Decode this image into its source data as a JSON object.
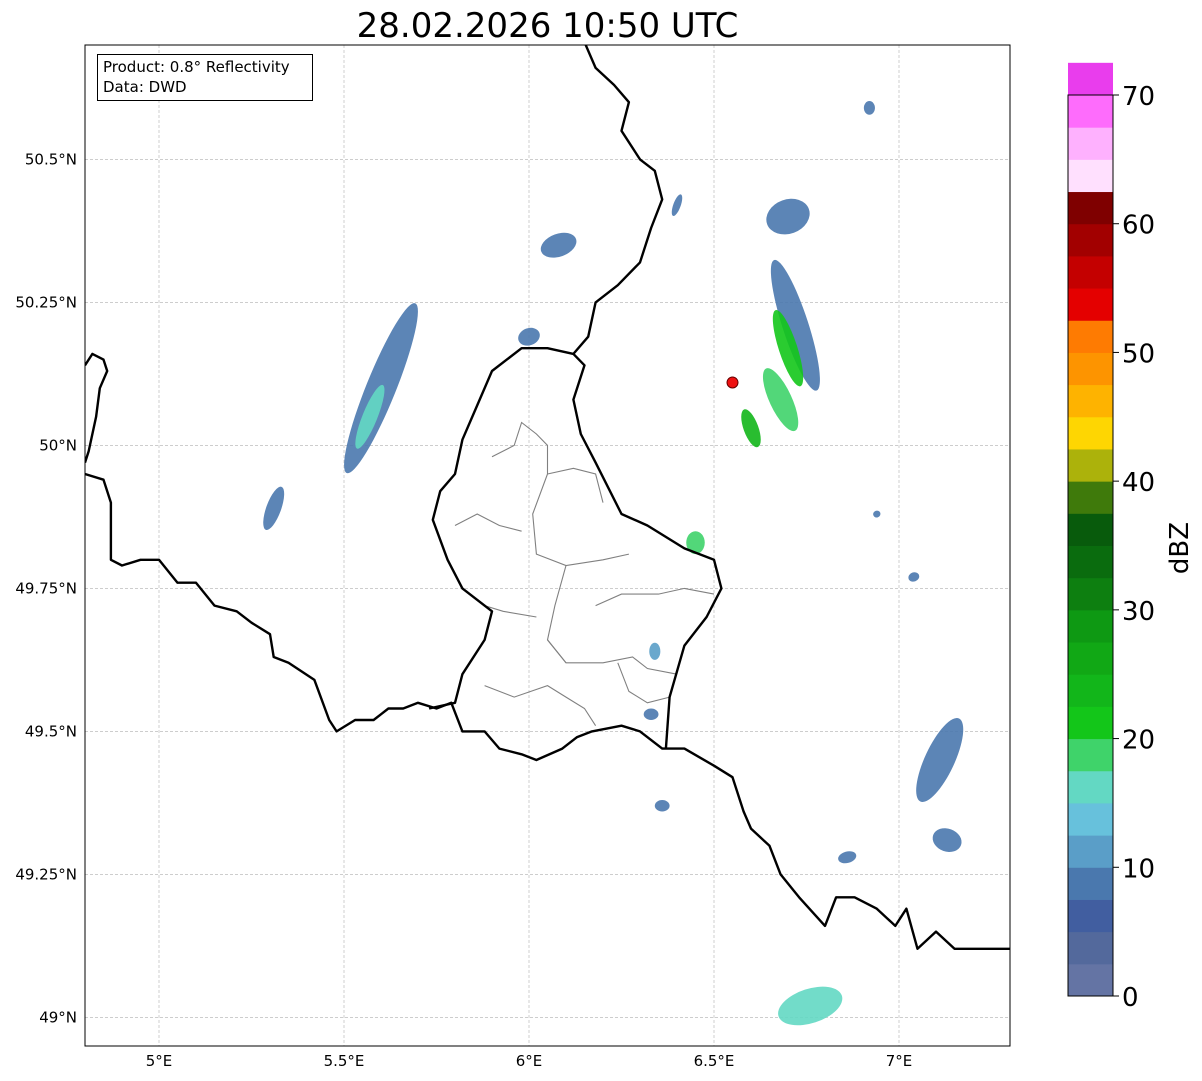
{
  "title": "28.02.2026 10:50 UTC",
  "info_box": {
    "product_line": "Product: 0.8° Reflectivity",
    "source_line": "Data: DWD"
  },
  "map": {
    "lon_range": [
      4.8,
      7.3
    ],
    "lat_range": [
      48.95,
      50.7
    ],
    "lon_ticks": [
      {
        "value": 5.0,
        "label": "5°E"
      },
      {
        "value": 5.5,
        "label": "5.5°E"
      },
      {
        "value": 6.0,
        "label": "6°E"
      },
      {
        "value": 6.5,
        "label": "6.5°E"
      },
      {
        "value": 7.0,
        "label": "7°E"
      }
    ],
    "lat_ticks": [
      {
        "value": 50.5,
        "label": "50.5°N"
      },
      {
        "value": 50.25,
        "label": "50.25°N"
      },
      {
        "value": 50.0,
        "label": "50°N"
      },
      {
        "value": 49.75,
        "label": "49.75°N"
      },
      {
        "value": 49.5,
        "label": "49.5°N"
      },
      {
        "value": 49.25,
        "label": "49.25°N"
      },
      {
        "value": 49.0,
        "label": "49°N"
      }
    ],
    "radar_site": {
      "lon": 6.55,
      "lat": 50.11
    },
    "gridlines": true
  },
  "colorbar": {
    "label": "dBZ",
    "min": 0,
    "max": 70,
    "step": 2.5,
    "tick_values": [
      0,
      10,
      20,
      30,
      40,
      50,
      60,
      70
    ],
    "tick_labels": [
      "0",
      "10",
      "20",
      "30",
      "40",
      "50",
      "60",
      "70"
    ],
    "colors": [
      "#6474a4",
      "#53699c",
      "#415ea0",
      "#4a78ae",
      "#5a9ec8",
      "#67c1dc",
      "#63d8c3",
      "#3fd36a",
      "#13c619",
      "#12b61a",
      "#11a815",
      "#0e9913",
      "#0d7f10",
      "#0a6c0e",
      "#085b0c",
      "#3f7a0b",
      "#acb20b",
      "#fed602",
      "#feb300",
      "#fd9400",
      "#fe7b02",
      "#e40000",
      "#c40000",
      "#a20000",
      "#7f0000",
      "#ffe0fe",
      "#feb1fe",
      "#fe6cfc",
      "#e93ded"
    ]
  },
  "echoes": [
    {
      "lon": 6.72,
      "lat": 50.21,
      "rx": 0.035,
      "ry": 0.12,
      "rot": -18,
      "color": "#4a78ae"
    },
    {
      "lon": 6.7,
      "lat": 50.17,
      "rx": 0.025,
      "ry": 0.07,
      "rot": -18,
      "color": "#13c619"
    },
    {
      "lon": 6.68,
      "lat": 50.08,
      "rx": 0.03,
      "ry": 0.06,
      "rot": -25,
      "color": "#3fd36a"
    },
    {
      "lon": 6.7,
      "lat": 50.4,
      "rx": 0.06,
      "ry": 0.03,
      "rot": -20,
      "color": "#4a78ae"
    },
    {
      "lon": 6.6,
      "lat": 50.03,
      "rx": 0.02,
      "ry": 0.035,
      "rot": -20,
      "color": "#12b61a"
    },
    {
      "lon": 5.6,
      "lat": 50.1,
      "rx": 0.04,
      "ry": 0.16,
      "rot": 22,
      "color": "#4a78ae"
    },
    {
      "lon": 5.57,
      "lat": 50.05,
      "rx": 0.02,
      "ry": 0.06,
      "rot": 22,
      "color": "#63d8c3"
    },
    {
      "lon": 5.31,
      "lat": 49.89,
      "rx": 0.02,
      "ry": 0.04,
      "rot": 20,
      "color": "#4a78ae"
    },
    {
      "lon": 6.08,
      "lat": 50.35,
      "rx": 0.05,
      "ry": 0.02,
      "rot": -20,
      "color": "#4a78ae"
    },
    {
      "lon": 6.45,
      "lat": 49.83,
      "rx": 0.025,
      "ry": 0.02,
      "rot": 0,
      "color": "#3fd36a"
    },
    {
      "lon": 7.11,
      "lat": 49.45,
      "rx": 0.04,
      "ry": 0.08,
      "rot": 25,
      "color": "#4a78ae"
    },
    {
      "lon": 7.13,
      "lat": 49.31,
      "rx": 0.04,
      "ry": 0.02,
      "rot": 20,
      "color": "#4a78ae"
    },
    {
      "lon": 6.76,
      "lat": 49.02,
      "rx": 0.09,
      "ry": 0.03,
      "rot": -18,
      "color": "#63d8c3"
    },
    {
      "lon": 6.36,
      "lat": 49.37,
      "rx": 0.02,
      "ry": 0.01,
      "rot": 0,
      "color": "#4a78ae"
    },
    {
      "lon": 6.86,
      "lat": 49.28,
      "rx": 0.025,
      "ry": 0.01,
      "rot": -15,
      "color": "#4a78ae"
    },
    {
      "lon": 6.33,
      "lat": 49.53,
      "rx": 0.02,
      "ry": 0.01,
      "rot": 0,
      "color": "#4a78ae"
    },
    {
      "lon": 6.34,
      "lat": 49.64,
      "rx": 0.015,
      "ry": 0.015,
      "rot": 0,
      "color": "#5a9ec8"
    },
    {
      "lon": 6.92,
      "lat": 50.59,
      "rx": 0.015,
      "ry": 0.012,
      "rot": 0,
      "color": "#4a78ae"
    },
    {
      "lon": 6.4,
      "lat": 50.42,
      "rx": 0.01,
      "ry": 0.02,
      "rot": 20,
      "color": "#4a78ae"
    },
    {
      "lon": 6.0,
      "lat": 50.19,
      "rx": 0.03,
      "ry": 0.015,
      "rot": -20,
      "color": "#4a78ae"
    },
    {
      "lon": 7.04,
      "lat": 49.77,
      "rx": 0.015,
      "ry": 0.008,
      "rot": -20,
      "color": "#4a78ae"
    },
    {
      "lon": 6.94,
      "lat": 49.88,
      "rx": 0.01,
      "ry": 0.006,
      "rot": -20,
      "color": "#4a78ae"
    }
  ],
  "borders": {
    "national": [
      [
        [
          4.8,
          50.14
        ],
        [
          4.82,
          50.16
        ],
        [
          4.85,
          50.15
        ],
        [
          4.86,
          50.13
        ],
        [
          4.84,
          50.1
        ],
        [
          4.83,
          50.05
        ],
        [
          4.81,
          49.99
        ],
        [
          4.8,
          49.97
        ]
      ],
      [
        [
          4.8,
          49.95
        ],
        [
          4.85,
          49.94
        ],
        [
          4.87,
          49.9
        ],
        [
          4.87,
          49.8
        ],
        [
          4.9,
          49.79
        ],
        [
          4.95,
          49.8
        ],
        [
          5.0,
          49.8
        ],
        [
          5.05,
          49.76
        ],
        [
          5.1,
          49.76
        ],
        [
          5.15,
          49.72
        ],
        [
          5.21,
          49.71
        ],
        [
          5.25,
          49.69
        ],
        [
          5.3,
          49.67
        ],
        [
          5.31,
          49.63
        ],
        [
          5.35,
          49.62
        ],
        [
          5.42,
          49.59
        ],
        [
          5.46,
          49.52
        ],
        [
          5.48,
          49.5
        ],
        [
          5.53,
          49.52
        ],
        [
          5.58,
          49.52
        ],
        [
          5.62,
          49.54
        ],
        [
          5.66,
          49.54
        ],
        [
          5.7,
          49.55
        ],
        [
          5.75,
          49.54
        ],
        [
          5.79,
          49.55
        ],
        [
          5.82,
          49.5
        ],
        [
          5.88,
          49.5
        ],
        [
          5.92,
          49.47
        ],
        [
          5.98,
          49.46
        ],
        [
          6.02,
          49.45
        ],
        [
          6.09,
          49.47
        ],
        [
          6.13,
          49.49
        ],
        [
          6.17,
          49.5
        ],
        [
          6.25,
          49.51
        ],
        [
          6.3,
          49.5
        ],
        [
          6.36,
          49.47
        ],
        [
          6.42,
          49.47
        ],
        [
          6.5,
          49.44
        ],
        [
          6.55,
          49.42
        ],
        [
          6.58,
          49.36
        ],
        [
          6.6,
          49.33
        ],
        [
          6.65,
          49.3
        ],
        [
          6.68,
          49.25
        ],
        [
          6.73,
          49.21
        ],
        [
          6.8,
          49.16
        ],
        [
          6.83,
          49.21
        ],
        [
          6.88,
          49.21
        ],
        [
          6.94,
          49.19
        ],
        [
          6.99,
          49.16
        ],
        [
          7.02,
          49.19
        ],
        [
          7.05,
          49.12
        ],
        [
          7.1,
          49.15
        ],
        [
          7.15,
          49.12
        ],
        [
          7.2,
          49.12
        ],
        [
          7.25,
          49.12
        ],
        [
          7.3,
          49.12
        ]
      ],
      [
        [
          5.73,
          49.54
        ],
        [
          5.8,
          49.55
        ],
        [
          5.82,
          49.6
        ],
        [
          5.88,
          49.66
        ],
        [
          5.9,
          49.71
        ],
        [
          5.82,
          49.75
        ],
        [
          5.78,
          49.8
        ],
        [
          5.74,
          49.87
        ],
        [
          5.76,
          49.92
        ],
        [
          5.8,
          49.95
        ],
        [
          5.82,
          50.01
        ],
        [
          5.86,
          50.07
        ],
        [
          5.9,
          50.13
        ],
        [
          5.98,
          50.17
        ],
        [
          6.05,
          50.17
        ],
        [
          6.12,
          50.16
        ],
        [
          6.15,
          50.14
        ],
        [
          6.12,
          50.08
        ],
        [
          6.14,
          50.02
        ],
        [
          6.18,
          49.97
        ],
        [
          6.25,
          49.88
        ],
        [
          6.32,
          49.86
        ],
        [
          6.42,
          49.82
        ],
        [
          6.5,
          49.8
        ],
        [
          6.52,
          49.75
        ],
        [
          6.48,
          49.7
        ],
        [
          6.42,
          49.65
        ],
        [
          6.38,
          49.56
        ],
        [
          6.37,
          49.47
        ]
      ],
      [
        [
          6.12,
          50.16
        ],
        [
          6.16,
          50.19
        ],
        [
          6.18,
          50.25
        ],
        [
          6.24,
          50.28
        ],
        [
          6.3,
          50.32
        ],
        [
          6.33,
          50.38
        ],
        [
          6.36,
          50.43
        ],
        [
          6.34,
          50.48
        ],
        [
          6.3,
          50.5
        ],
        [
          6.25,
          50.55
        ],
        [
          6.27,
          50.6
        ],
        [
          6.23,
          50.63
        ],
        [
          6.18,
          50.66
        ],
        [
          6.14,
          50.72
        ]
      ]
    ],
    "regional": [
      [
        [
          5.9,
          49.98
        ],
        [
          5.96,
          50.0
        ],
        [
          5.98,
          50.04
        ],
        [
          6.02,
          50.02
        ],
        [
          6.05,
          50.0
        ],
        [
          6.05,
          49.95
        ],
        [
          6.01,
          49.88
        ],
        [
          6.02,
          49.81
        ],
        [
          6.1,
          49.79
        ],
        [
          6.2,
          49.8
        ],
        [
          6.27,
          49.81
        ]
      ],
      [
        [
          5.8,
          49.86
        ],
        [
          5.86,
          49.88
        ],
        [
          5.92,
          49.86
        ],
        [
          5.98,
          49.85
        ]
      ],
      [
        [
          6.1,
          49.79
        ],
        [
          6.07,
          49.72
        ],
        [
          6.05,
          49.66
        ],
        [
          6.1,
          49.62
        ],
        [
          6.2,
          49.62
        ],
        [
          6.28,
          49.63
        ],
        [
          6.32,
          49.61
        ],
        [
          6.4,
          49.6
        ]
      ],
      [
        [
          6.02,
          49.7
        ],
        [
          5.93,
          49.71
        ],
        [
          5.88,
          49.72
        ]
      ],
      [
        [
          6.18,
          49.72
        ],
        [
          6.25,
          49.74
        ],
        [
          6.35,
          49.74
        ],
        [
          6.42,
          49.75
        ],
        [
          6.5,
          49.74
        ]
      ],
      [
        [
          5.88,
          49.58
        ],
        [
          5.96,
          49.56
        ],
        [
          6.05,
          49.58
        ],
        [
          6.1,
          49.56
        ],
        [
          6.15,
          49.54
        ],
        [
          6.18,
          49.51
        ]
      ],
      [
        [
          6.1,
          49.62
        ],
        [
          6.05,
          49.66
        ]
      ],
      [
        [
          6.24,
          49.62
        ],
        [
          6.27,
          49.57
        ],
        [
          6.32,
          49.55
        ],
        [
          6.38,
          49.56
        ]
      ],
      [
        [
          6.05,
          49.95
        ],
        [
          6.12,
          49.96
        ],
        [
          6.18,
          49.95
        ],
        [
          6.2,
          49.9
        ]
      ]
    ]
  }
}
